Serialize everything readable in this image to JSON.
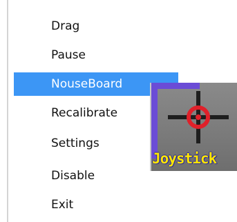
{
  "context_menu": {
    "items": [
      {
        "label": "Drag",
        "active": false
      },
      {
        "label": "Pause",
        "active": false
      },
      {
        "label": "NouseBoard",
        "active": true
      },
      {
        "label": "Recalibrate",
        "active": false
      },
      {
        "label": "Settings",
        "active": false
      },
      {
        "label": "Disable",
        "active": false
      },
      {
        "label": "Exit",
        "active": false
      }
    ],
    "highlight_color": "#3c96f5"
  },
  "tray_icon": {
    "icon": "joystick-crosshair-icon",
    "label": "Joystick",
    "colors": {
      "frame": "#6b4cd6",
      "crosshair": "#e0202a",
      "text": "#ffe600"
    }
  }
}
